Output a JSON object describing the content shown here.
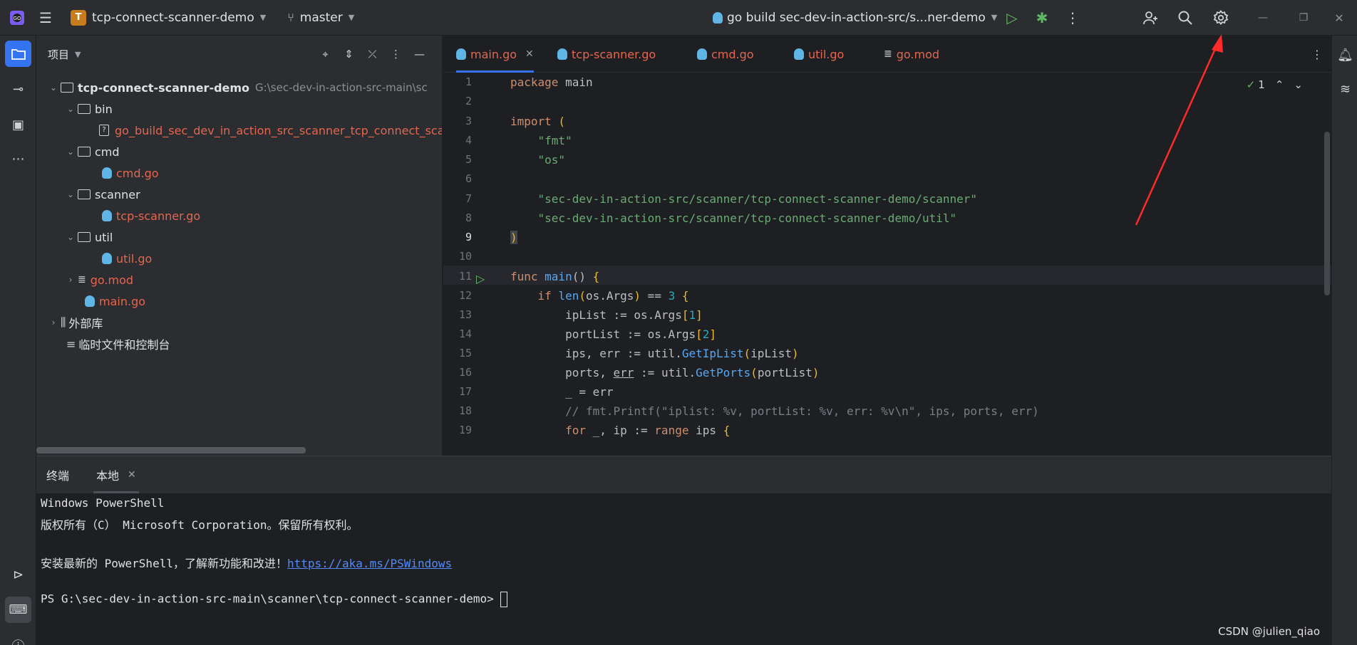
{
  "titlebar": {
    "project_badge": "T",
    "project_name": "tcp-connect-scanner-demo",
    "branch": "master",
    "run_config": "go build sec-dev-in-action-src/s...ner-demo"
  },
  "project_panel": {
    "title": "项目",
    "tree": [
      {
        "label": "tcp-connect-scanner-demo",
        "path": "G:\\sec-dev-in-action-src-main\\sc"
      },
      {
        "label": "bin"
      },
      {
        "label": "go_build_sec_dev_in_action_src_scanner_tcp_connect_scann"
      },
      {
        "label": "cmd"
      },
      {
        "label": "cmd.go"
      },
      {
        "label": "scanner"
      },
      {
        "label": "tcp-scanner.go"
      },
      {
        "label": "util"
      },
      {
        "label": "util.go"
      },
      {
        "label": "go.mod"
      },
      {
        "label": "main.go"
      },
      {
        "label": "外部库"
      },
      {
        "label": "临时文件和控制台"
      }
    ]
  },
  "editor": {
    "tabs": [
      {
        "label": "main.go",
        "active": true
      },
      {
        "label": "tcp-scanner.go"
      },
      {
        "label": "cmd.go"
      },
      {
        "label": "util.go"
      },
      {
        "label": "go.mod"
      }
    ],
    "inspection_count": "1",
    "line_numbers": [
      "1",
      "2",
      "3",
      "4",
      "5",
      "6",
      "7",
      "8",
      "9",
      "10",
      "11",
      "12",
      "13",
      "14",
      "15",
      "16",
      "17",
      "18",
      "19"
    ],
    "current_line": "9"
  },
  "terminal": {
    "tab_title": "终端",
    "tab_local": "本地",
    "lines": [
      "Windows PowerShell",
      "版权所有（C） Microsoft Corporation。保留所有权利。",
      "",
      "安装最新的 PowerShell，了解新功能和改进！",
      "",
      "PS G:\\sec-dev-in-action-src-main\\scanner\\tcp-connect-scanner-demo> "
    ],
    "link": "https://aka.ms/PSWindows"
  },
  "watermark": "CSDN @julien_qiao",
  "colors": {
    "accent": "#3574f0",
    "annotation": "#ff2a2a"
  }
}
